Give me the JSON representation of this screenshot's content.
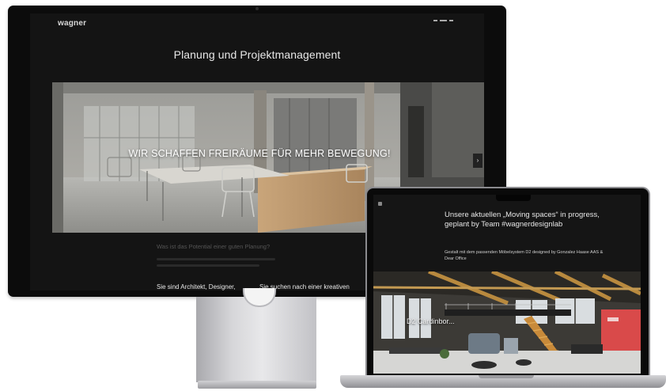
{
  "monitor": {
    "brand": "wagner",
    "heading": "Planung und Projektmanagement",
    "hero_caption": "WIR SCHAFFEN FREIRÄUME FÜR MEHR BEWEGUNG!",
    "slider_arrow": "›",
    "question": "Was ist das Potential einer guten Planung?",
    "cta_left": "Sie sind Architekt, Designer,",
    "cta_right": "Sie suchen nach einer kreativen"
  },
  "laptop": {
    "heading": "Unsere aktuellen „Moving spaces“ in progress, geplant by Team #wagnerdesignlab",
    "subtext": "Gestalt mit dem passenden Möbelsystem D2 designed by Gonzalez Haase AAS & Dear Office",
    "photo_caption": "D2 Cardinbor..."
  },
  "colors": {
    "screen_bg": "#141414",
    "brand_accent": "#e04a4a",
    "stand_silver": "#d6d6d9"
  }
}
